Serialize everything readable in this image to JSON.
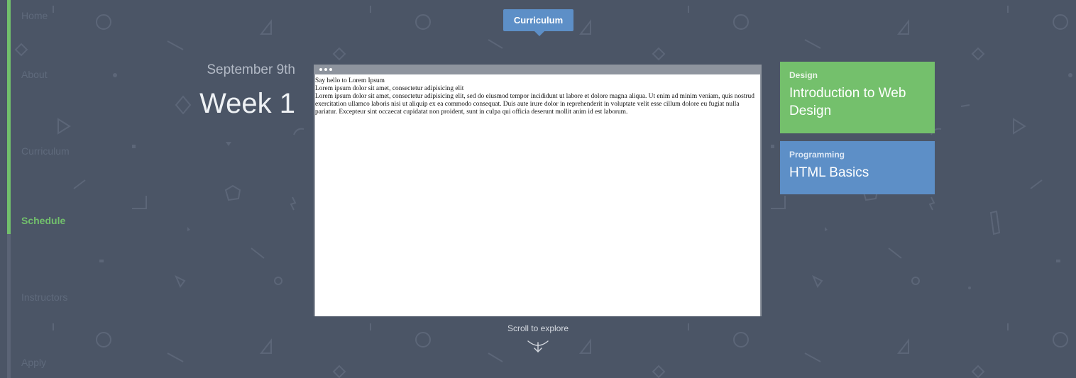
{
  "nav": {
    "items": [
      {
        "label": "Home",
        "active": false
      },
      {
        "label": "About",
        "active": false
      },
      {
        "label": "Curriculum",
        "active": false
      },
      {
        "label": "Schedule",
        "active": true
      },
      {
        "label": "Instructors",
        "active": false
      },
      {
        "label": "Apply",
        "active": false
      }
    ]
  },
  "header": {
    "tab_label": "Curriculum"
  },
  "schedule": {
    "date": "September 9th",
    "week": "Week 1"
  },
  "browser": {
    "line1": "Say hello to Lorem Ipsum",
    "line2": "Lorem ipsum dolor sit amet, consectetur adipisicing elit",
    "paragraph": "Lorem ipsum dolor sit amet, consectetur adipisicing elit, sed do eiusmod tempor incididunt ut labore et dolore magna aliqua. Ut enim ad minim veniam, quis nostrud exercitation ullamco laboris nisi ut aliquip ex ea commodo consequat. Duis aute irure dolor in reprehenderit in voluptate velit esse cillum dolore eu fugiat nulla pariatur. Excepteur sint occaecat cupidatat non proident, sunt in culpa qui officia deserunt mollit anim id est laborum."
  },
  "cards": [
    {
      "category": "Design",
      "title": "Introduction to Web Design"
    },
    {
      "category": "Programming",
      "title": "HTML Basics"
    }
  ],
  "footer": {
    "scroll_hint": "Scroll to explore"
  },
  "colors": {
    "background": "#4b5566",
    "green": "#74c06c",
    "blue": "#5d8fc7",
    "nav_text": "#5f6a7c"
  },
  "icons": [
    "window-dots-icon",
    "scroll-down-arrow-icon"
  ]
}
